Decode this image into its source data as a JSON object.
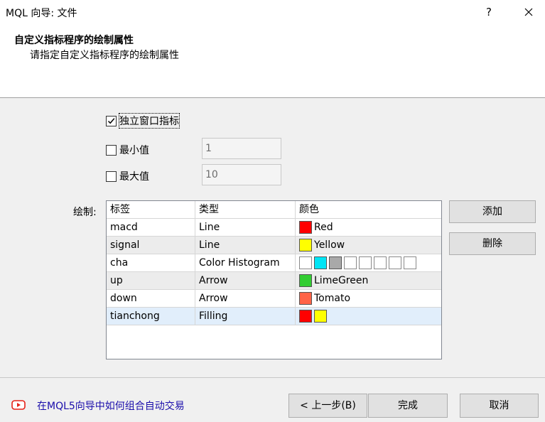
{
  "window": {
    "title": "MQL 向导: 文件",
    "help_label": "?"
  },
  "header": {
    "title": "自定义指标程序的绘制属性",
    "subtitle": "请指定自定义指标程序的绘制属性"
  },
  "options": {
    "separate_window": {
      "label": "独立窗口指标",
      "checked": true
    },
    "minimum": {
      "label": "最小值",
      "checked": false,
      "value": "1"
    },
    "maximum": {
      "label": "最大值",
      "checked": false,
      "value": "10"
    }
  },
  "plots": {
    "label": "绘制:",
    "columns": [
      "标签",
      "类型",
      "颜色"
    ],
    "rows": [
      {
        "label": "macd",
        "type": "Line",
        "color_name": "Red",
        "colors": [
          "#ff0000"
        ]
      },
      {
        "label": "signal",
        "type": "Line",
        "color_name": "Yellow",
        "colors": [
          "#ffff00"
        ]
      },
      {
        "label": "cha",
        "type": "Color Histogram",
        "color_name": "",
        "colors": [
          "#ffffff",
          "#00e5f5",
          "#a9a9a9",
          "#ffffff",
          "#ffffff",
          "#ffffff",
          "#ffffff",
          "#ffffff"
        ]
      },
      {
        "label": "up",
        "type": "Arrow",
        "color_name": "LimeGreen",
        "colors": [
          "#32cd32"
        ]
      },
      {
        "label": "down",
        "type": "Arrow",
        "color_name": "Tomato",
        "colors": [
          "#ff6347"
        ]
      },
      {
        "label": "tianchong",
        "type": "Filling",
        "color_name": "",
        "colors": [
          "#ff0000",
          "#ffff00"
        ]
      }
    ],
    "selected_row": 5
  },
  "side_buttons": {
    "add": "添加",
    "delete": "删除"
  },
  "footer": {
    "help_link": "在MQL5向导中如何组合自动交易",
    "back": "< 上一步(B)",
    "finish": "完成",
    "cancel": "取消"
  },
  "colors": {
    "accent_link": "#1a0dab",
    "youtube_red": "#e62117"
  }
}
